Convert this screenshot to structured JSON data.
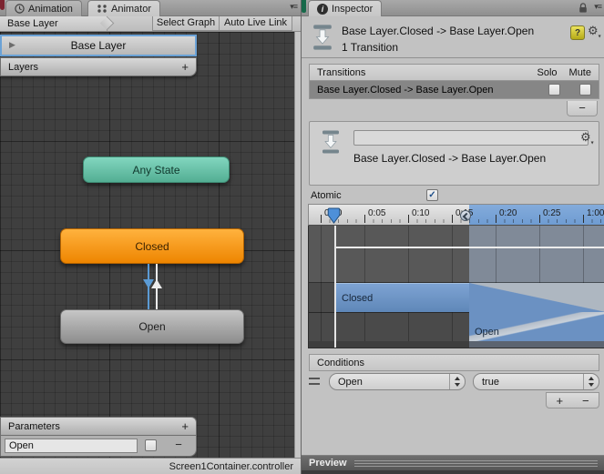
{
  "icons": {
    "pane_menu": "▾≡",
    "foldout": "▶",
    "plus": "+",
    "minus": "−",
    "gear": "⚙",
    "gear_drop": "▾",
    "help": "?",
    "info": "i",
    "check": "✓"
  },
  "colors": {
    "accent_blue": "#5b9bd5",
    "node_orange": "#f09000",
    "node_teal": "#66c2a5",
    "node_gray": "#a8a8a8",
    "timeline_blue": "#6b91c2",
    "ruler_selection": "#79a5d8"
  },
  "animator": {
    "tabs": [
      {
        "label": "Animation"
      },
      {
        "label": "Animator"
      }
    ],
    "breadcrumb": {
      "label": "Base Layer"
    },
    "toolbar": {
      "select_graph": "Select Graph",
      "auto_live_link": "Auto Live Link"
    },
    "layer_row": {
      "label": "Base Layer"
    },
    "layers_bar": {
      "label": "Layers"
    },
    "graph": {
      "nodes": [
        {
          "label": "Any State"
        },
        {
          "label": "Closed"
        },
        {
          "label": "Open"
        }
      ]
    },
    "parameters": {
      "label": "Parameters",
      "rows": [
        {
          "name": "Open",
          "checked": false
        }
      ]
    },
    "status_bar": {
      "controller": "Screen1Container.controller"
    }
  },
  "inspector": {
    "tab": {
      "label": "Inspector"
    },
    "header": {
      "title": "Base Layer.Closed -> Base Layer.Open",
      "subtitle": "1 Transition"
    },
    "transitions": {
      "title": "Transitions",
      "solo_label": "Solo",
      "mute_label": "Mute",
      "rows": [
        {
          "label": "Base Layer.Closed -> Base Layer.Open",
          "solo": false,
          "mute": false
        }
      ]
    },
    "transition_detail": {
      "name_value": "",
      "label": "Base Layer.Closed -> Base Layer.Open"
    },
    "settings": {
      "atomic_label": "Atomic",
      "atomic_checked": true
    },
    "timeline": {
      "ticks": [
        "0:00",
        "0:05",
        "0:10",
        "0:15",
        "0:20",
        "0:25",
        "1:00"
      ],
      "tracks": [
        {
          "label": "Closed"
        },
        {
          "label": "Open"
        }
      ]
    },
    "conditions": {
      "title": "Conditions",
      "rows": [
        {
          "parameter": "Open",
          "value": "true"
        }
      ]
    },
    "preview": {
      "label": "Preview"
    }
  }
}
